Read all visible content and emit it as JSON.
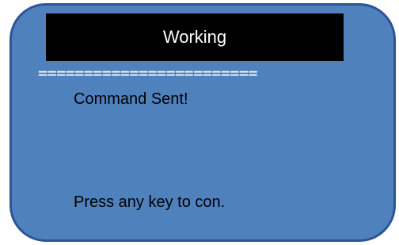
{
  "screen": {
    "title": "Working",
    "separator": "========================",
    "message": "Command Sent!",
    "prompt": "Press any key to con."
  },
  "colors": {
    "screen_background": "#4f81bd",
    "screen_border": "#2f5597",
    "title_bar": "#000000",
    "title_text": "#ffffff",
    "body_text": "#000000"
  }
}
